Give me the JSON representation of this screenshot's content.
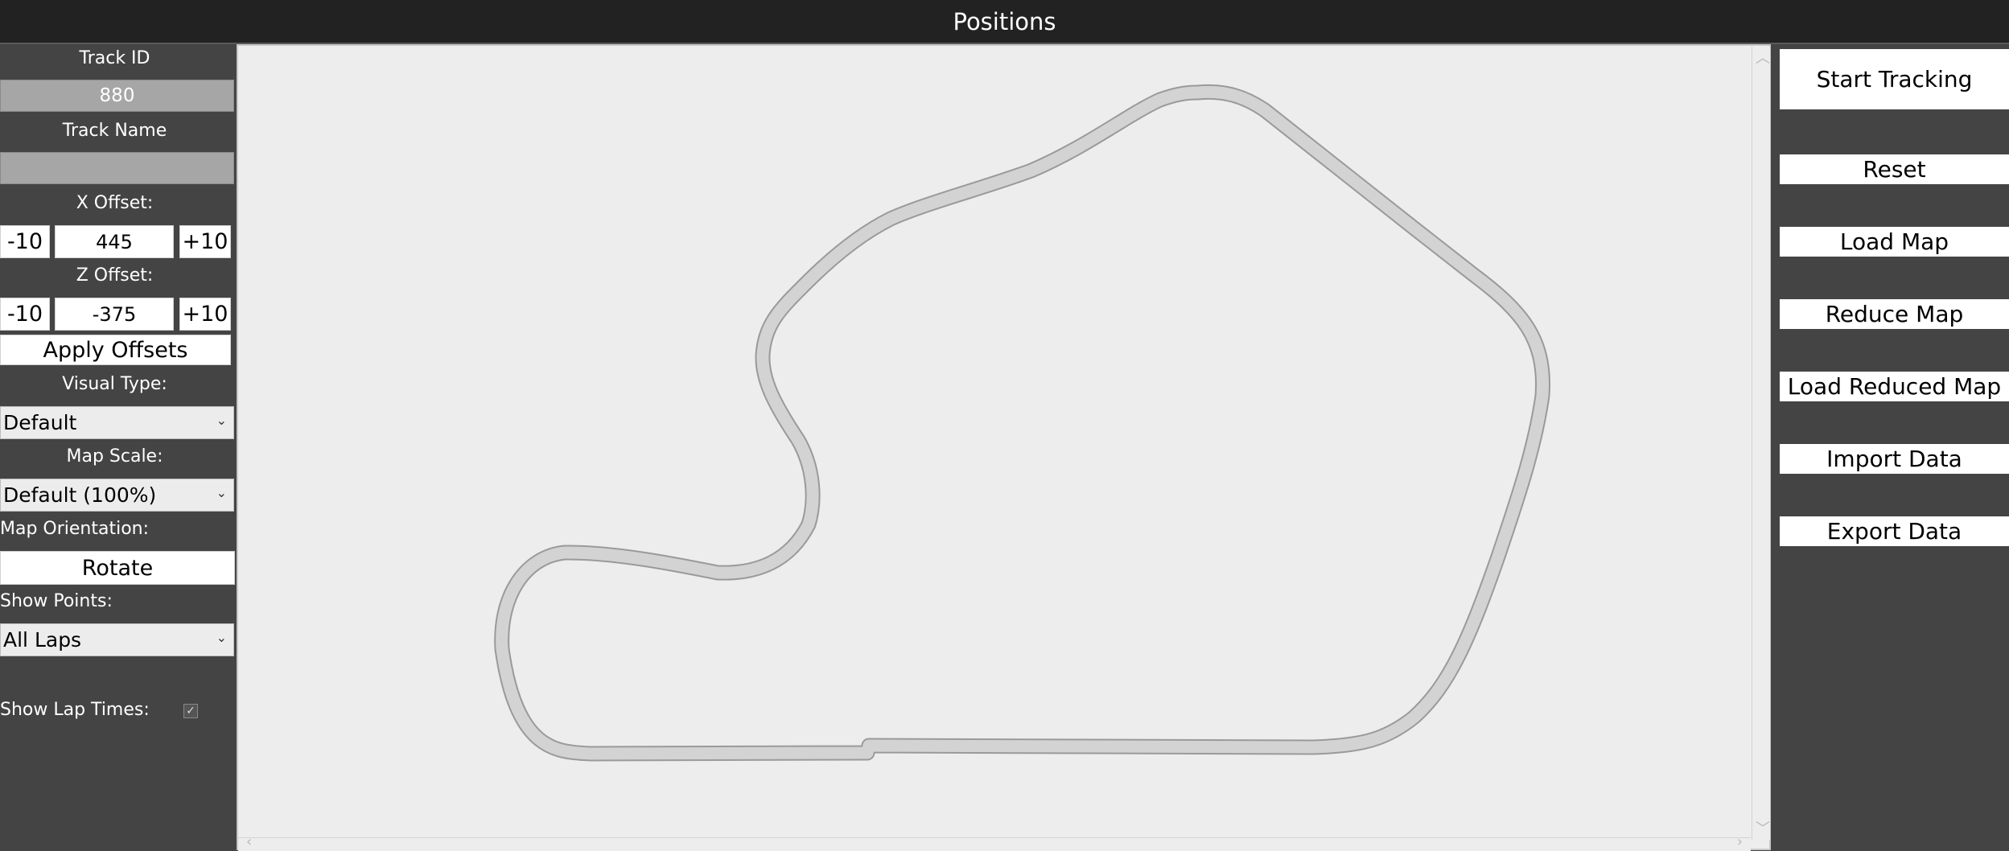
{
  "window": {
    "title": "Positions"
  },
  "left_panel": {
    "track_id_label": "Track ID",
    "track_id_value": "880",
    "track_name_label": "Track Name",
    "track_name_value": "",
    "x_offset": {
      "label": "X Offset:",
      "minus": "-10",
      "value": "445",
      "plus": "+10"
    },
    "z_offset": {
      "label": "Z Offset:",
      "minus": "-10",
      "value": "-375",
      "plus": "+10"
    },
    "apply_offsets": "Apply Offsets",
    "visual_type": {
      "label": "Visual Type:",
      "selected": "Default"
    },
    "map_scale": {
      "label": "Map Scale:",
      "selected": "Default (100%)"
    },
    "map_orientation": {
      "label": "Map Orientation:",
      "button": "Rotate"
    },
    "show_points": {
      "label": "Show Points:",
      "selected": "All Laps"
    },
    "show_lap_times": {
      "label": "Show Lap Times:",
      "checked": true,
      "glyph": "✓"
    }
  },
  "right_panel": {
    "start_tracking": "Start Tracking",
    "reset": "Reset",
    "load_map": "Load Map",
    "reduce_map": "Reduce Map",
    "load_reduced_map": "Load Reduced Map",
    "import_data": "Import Data",
    "export_data": "Export Data"
  },
  "icons": {
    "chevron": "⌄",
    "scroll_up": "︿",
    "scroll_down": "﹀",
    "scroll_left": "‹",
    "scroll_right": "›"
  },
  "colors": {
    "panel_bg": "#444444",
    "titlebar_bg": "#222222",
    "map_bg": "#ededed",
    "track_fill": "#d3d3d3",
    "track_stroke": "#9a9a9a"
  }
}
